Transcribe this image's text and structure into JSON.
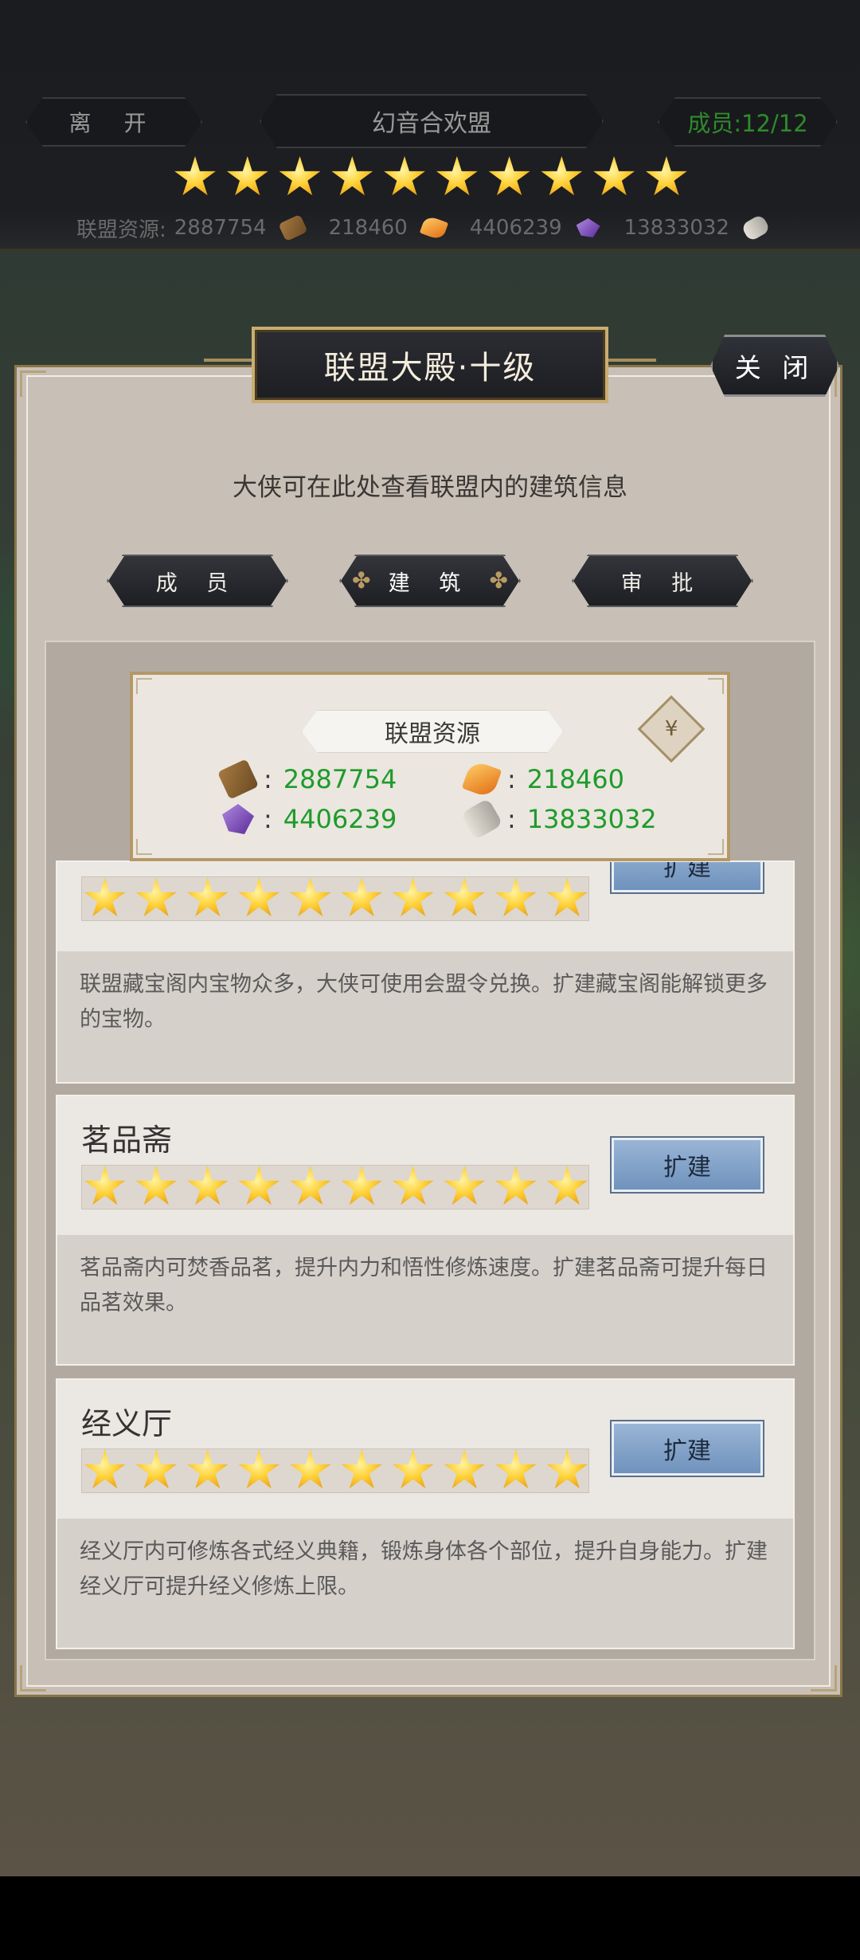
{
  "header": {
    "leave_label": "离 开",
    "alliance_name": "幻音合欢盟",
    "member_count": "成员:12/12",
    "star_count": 10,
    "resources_label": "联盟资源:",
    "resources": [
      "2887754",
      "218460",
      "4406239",
      "13833032"
    ]
  },
  "panel": {
    "title": "联盟大殿·十级",
    "close_label": "关 闭",
    "subtitle": "大侠可在此处查看联盟内的建筑信息",
    "tabs": [
      {
        "label": "成 员",
        "active": false
      },
      {
        "label": "建 筑",
        "active": true
      },
      {
        "label": "审 批",
        "active": false
      }
    ]
  },
  "resource_popup": {
    "title": "联盟资源",
    "bag_icon": "money-bag-icon",
    "wood": "2887754",
    "gem": "218460",
    "crystal": "4406239",
    "scroll": "13833032"
  },
  "buildings": [
    {
      "name": "",
      "stars": 10,
      "expand_label": "扩建",
      "desc": "联盟藏宝阁内宝物众多，大侠可使用会盟令兑换。扩建藏宝阁能解锁更多的宝物。"
    },
    {
      "name": "茗品斋",
      "stars": 10,
      "expand_label": "扩建",
      "desc": "茗品斋内可焚香品茗，提升内力和悟性修炼速度。扩建茗品斋可提升每日品茗效果。"
    },
    {
      "name": "经义厅",
      "stars": 10,
      "expand_label": "扩建",
      "desc": "经义厅内可修炼各式经义典籍，锻炼身体各个部位，提升自身能力。扩建经义厅可提升经义修炼上限。"
    }
  ],
  "colors": {
    "resource_value": "#1e9b2b",
    "member_count": "#2f8a2c",
    "star": "#ffd23a",
    "expand_button": "#7f9fc8"
  }
}
